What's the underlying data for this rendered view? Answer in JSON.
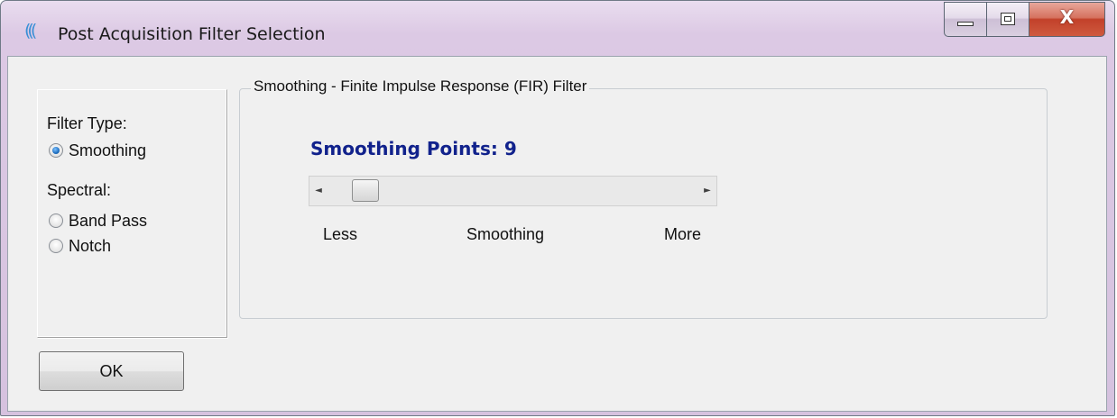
{
  "window": {
    "title": "Post Acquisition Filter Selection",
    "app_icon": "signal-waves-icon",
    "close_glyph": "X"
  },
  "filter_type": {
    "heading": "Filter Type:",
    "smoothing_label": "Smoothing",
    "spectral_heading": "Spectral:",
    "band_pass_label": "Band Pass",
    "notch_label": "Notch",
    "selected": "Smoothing"
  },
  "group": {
    "title": "Smoothing - Finite Impulse Response (FIR) Filter",
    "points_text": "Smoothing Points: 9",
    "slider_position": 0.07,
    "scale_less": "Less",
    "scale_middle": "Smoothing",
    "scale_more": "More"
  },
  "buttons": {
    "ok_label": "OK"
  },
  "colors": {
    "points_label": "#11228c",
    "radio_accent": "#1f6fc0",
    "close_button": "#c2412a"
  }
}
